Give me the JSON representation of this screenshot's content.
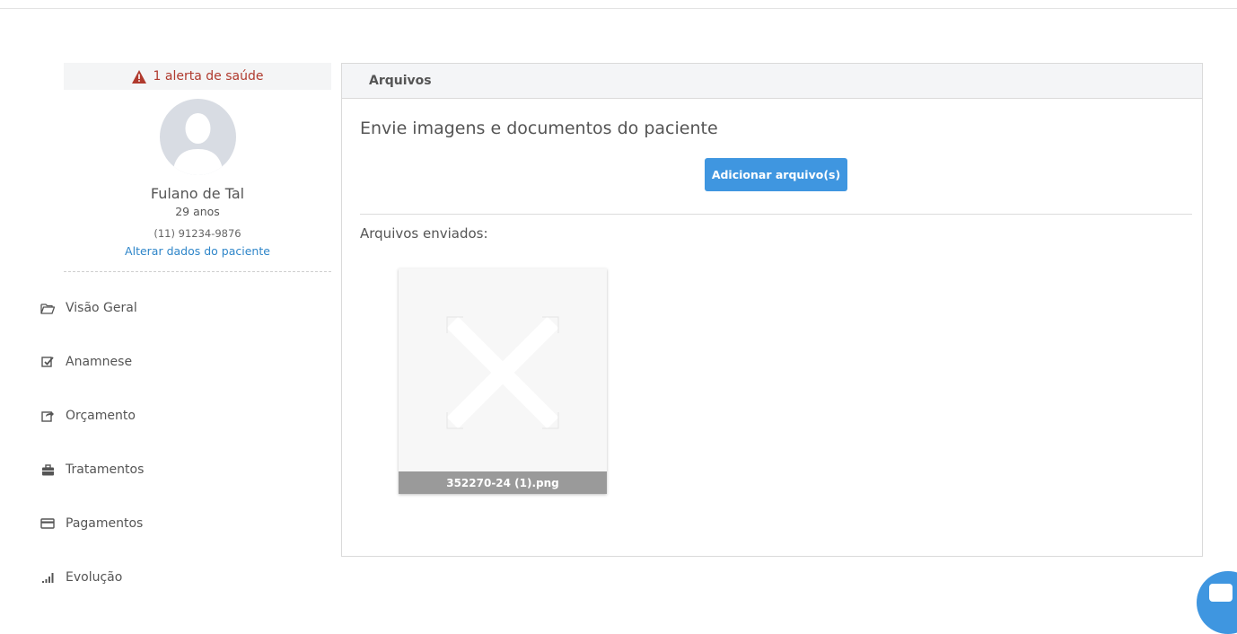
{
  "alert": {
    "text": "1 alerta de saúde",
    "icon": "warning-triangle-icon",
    "color": "#b03a2e"
  },
  "patient": {
    "name": "Fulano de Tal",
    "age": "29 anos",
    "phone": "(11) 91234-9876",
    "edit_link": "Alterar dados do paciente"
  },
  "nav": {
    "items": [
      {
        "label": "Visão Geral",
        "icon": "folder-open-icon"
      },
      {
        "label": "Anamnese",
        "icon": "checkbox-icon"
      },
      {
        "label": "Orçamento",
        "icon": "share-icon"
      },
      {
        "label": "Tratamentos",
        "icon": "briefcase-icon"
      },
      {
        "label": "Pagamentos",
        "icon": "credit-card-icon"
      },
      {
        "label": "Evolução",
        "icon": "signal-icon"
      }
    ]
  },
  "main": {
    "header": "Arquivos",
    "subtitle": "Envie imagens e documentos do paciente",
    "add_button": "Adicionar arquivo(s)",
    "sent_label": "Arquivos enviados:",
    "files": [
      {
        "name": "352270-24 (1).png"
      }
    ]
  },
  "colors": {
    "accent": "#3f96e0",
    "link": "#2f86c9"
  }
}
